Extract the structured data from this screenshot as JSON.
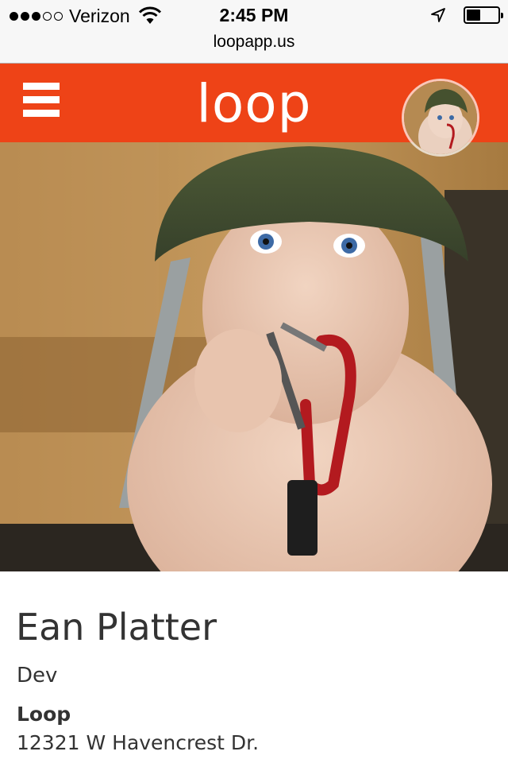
{
  "status_bar": {
    "carrier": "Verizon",
    "signal_bars_filled": 3,
    "signal_bars_total": 5,
    "time": "2:45 PM",
    "battery_level": 0.4
  },
  "browser": {
    "url": "loopapp.us"
  },
  "app_bar": {
    "color": "#ee4317",
    "logo": "loop",
    "menu_icon": "hamburger-menu-icon",
    "avatar": "profile-avatar"
  },
  "profile": {
    "name": "Ean Platter",
    "title": "Dev",
    "company": "Loop",
    "address": "12321 W Havencrest Dr."
  }
}
